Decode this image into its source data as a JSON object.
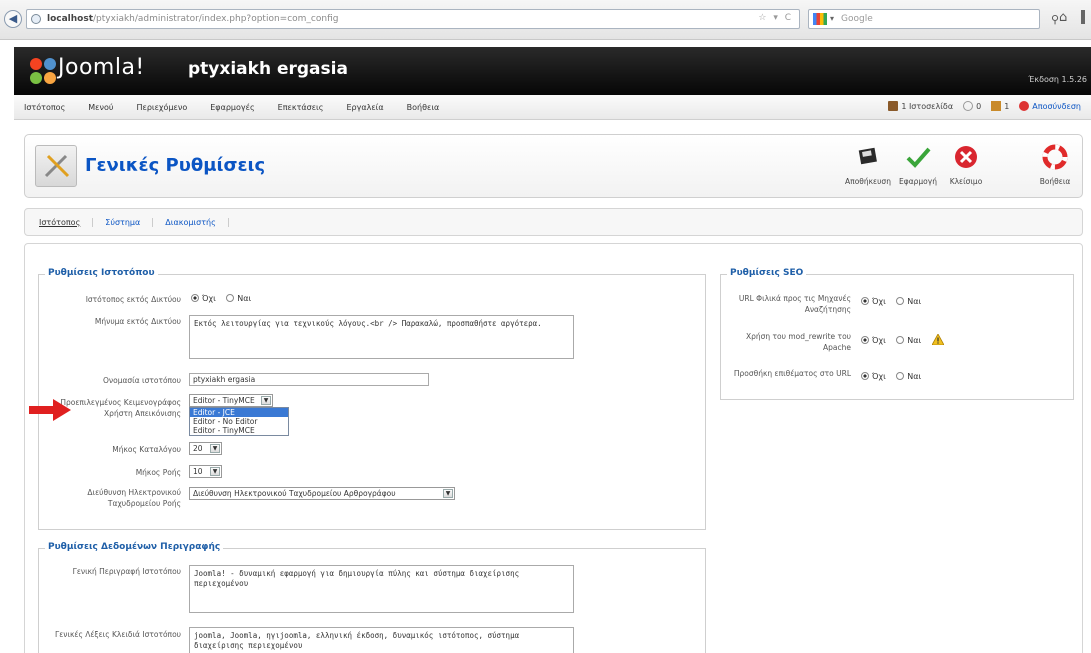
{
  "browser": {
    "url_host": "localhost",
    "url_path": "/ptyxiakh/administrator/index.php?option=com_config",
    "search_placeholder": "Google"
  },
  "header": {
    "logo_text": "Joomla!",
    "site_name": "ptyxiakh ergasia",
    "version": "Έκδοση 1.5.26"
  },
  "menu": {
    "items": [
      "Ιστότοπος",
      "Μενού",
      "Περιεχόμενο",
      "Εφαρμογές",
      "Επεκτάσεις",
      "Εργαλεία",
      "Βοήθεια"
    ],
    "status": [
      "1 Ιστοσελίδα",
      "0",
      "1",
      "Αποσύνδεση"
    ]
  },
  "toolbar": {
    "title": "Γενικές Ρυθμίσεις",
    "buttons": [
      "Αποθήκευση",
      "Εφαρμογή",
      "Κλείσιμο",
      "Βοήθεια"
    ]
  },
  "tabs": [
    "Ιστότοπος",
    "Σύστημα",
    "Διακομιστής"
  ],
  "site_settings": {
    "legend": "Ρυθμίσεις Ιστοτόπου",
    "offline_label": "Ιστότοπος εκτός Δικτύου",
    "offline_options": [
      "Όχι",
      "Ναι"
    ],
    "offline_message_label": "Μήνυμα εκτός Δικτύου",
    "offline_message": "Εκτός λειτουργίας για τεχνικούς λόγους.<br /> Παρακαλώ, προσπαθήστε αργότερα.",
    "site_name_label": "Ονομασία ιστοτόπου",
    "site_name": "ptyxiakh ergasia",
    "editor_label": "Προεπιλεγμένος Κειμενογράφος Χρήστη Απεικόνισης",
    "editor_value": "Editor - TinyMCE",
    "editor_options": [
      "Editor - JCE",
      "Editor - No Editor",
      "Editor - TinyMCE"
    ],
    "list_length_label": "Μήκος Καταλόγου",
    "list_length": "20",
    "feed_length_label": "Μήκος Ροής",
    "feed_length": "10",
    "feed_email_label": "Διεύθυνση Ηλεκτρονικού Ταχυδρομείου Ροής",
    "feed_email": "Διεύθυνση Ηλεκτρονικού Ταχυδρομείου Αρθρογράφου"
  },
  "metadata": {
    "legend": "Ρυθμίσεις Δεδομένων Περιγραφής",
    "description_label": "Γενική Περιγραφή Ιστοτόπου",
    "description": "Joomla! - δυναμική εφαρμογή για δημιουργία πύλης και σύστημα διαχείρισης περιεχομένου",
    "keywords_label": "Γενικές Λέξεις Κλειδιά Ιστοτόπου",
    "keywords": "joomla, Joomla, ηγιjoomla, ελληνική έκδοση, δυναμικός ιστότοπος, σύστημα διαχείρισης περιεχομένου"
  },
  "seo": {
    "legend": "Ρυθμίσεις SEO",
    "rows": [
      {
        "label": "URL Φιλικά προς τις Μηχανές Αναζήτησης",
        "options": [
          "Όχι",
          "Ναι"
        ]
      },
      {
        "label": "Χρήση του mod_rewrite του Apache",
        "options": [
          "Όχι",
          "Ναι"
        ]
      },
      {
        "label": "Προσθήκη επιθέματος στο URL",
        "options": [
          "Όχι",
          "Ναι"
        ]
      }
    ]
  },
  "colors": {
    "title_blue": "#0b55c4",
    "legend_blue": "#1f5fa8",
    "header_black": "#0a0a0a",
    "arrow_red": "#e02020"
  }
}
